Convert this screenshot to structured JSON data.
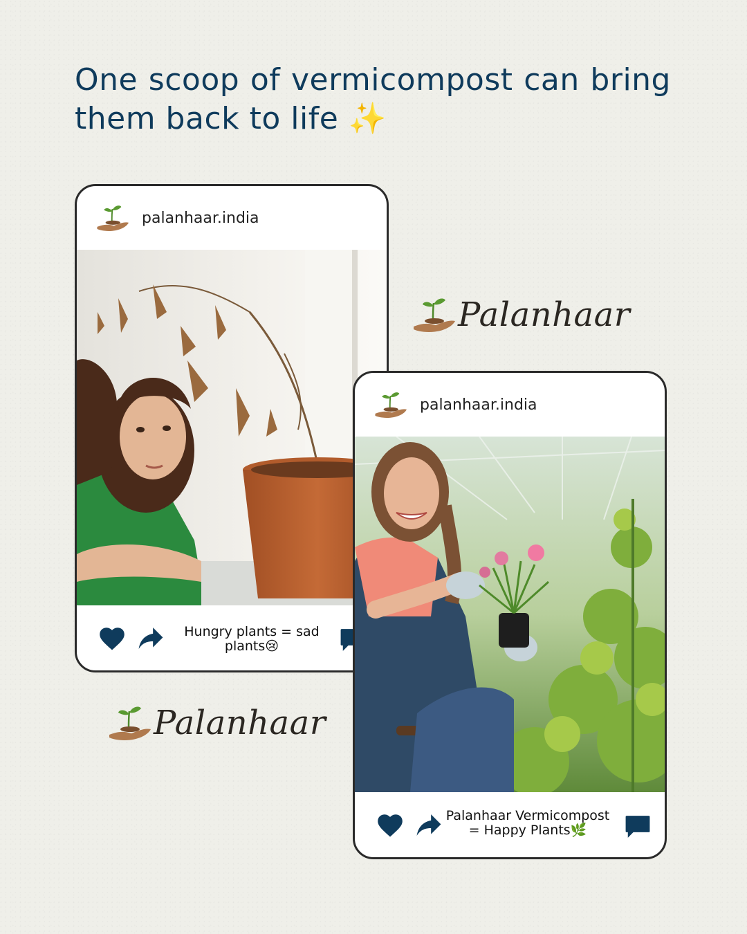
{
  "headline": {
    "text": "One scoop of vermicompost can bring them back to life",
    "emoji": "✨"
  },
  "brand": {
    "name": "Palanhaar",
    "logo_icon": "hand-with-sprout-icon"
  },
  "posts": [
    {
      "handle": "palanhaar.india",
      "caption_line1": "Hungry plants = sad",
      "caption_line2": "plants",
      "caption_emoji": "😢",
      "image": "woman-looking-at-dead-plant",
      "icons": [
        "heart-icon",
        "share-icon",
        "comment-icon"
      ]
    },
    {
      "handle": "palanhaar.india",
      "caption_line1": "Palanhaar Vermicompost",
      "caption_line2": "= Happy Plants",
      "caption_emoji": "🌿",
      "image": "smiling-woman-holding-plant-in-greenhouse",
      "icons": [
        "heart-icon",
        "share-icon",
        "comment-icon"
      ]
    }
  ],
  "colors": {
    "background": "#efefe9",
    "headline": "#0f3b5c",
    "icon": "#0f3b5c",
    "brand_text": "#2b2722",
    "logo_hand": "#b07a4e",
    "logo_sprout": "#4f8a2b"
  }
}
